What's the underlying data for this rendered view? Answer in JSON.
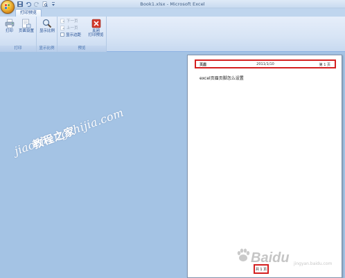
{
  "window": {
    "title": "Book1.xlsx - Microsoft Excel"
  },
  "quick_access": [
    "save-icon",
    "undo-icon",
    "redo-icon",
    "print-preview-icon",
    "customize-icon"
  ],
  "tabs": [
    {
      "label": "打印预览",
      "active": true
    }
  ],
  "ribbon": {
    "groups": [
      {
        "label": "打印",
        "buttons": [
          {
            "label": "打印",
            "icon": "printer-icon"
          },
          {
            "label": "页面设置",
            "icon": "page-setup-icon"
          }
        ]
      },
      {
        "label": "显示比例",
        "buttons": [
          {
            "label": "显示比例",
            "icon": "magnifier-icon"
          }
        ]
      },
      {
        "label": "预览",
        "small_buttons": [
          {
            "label": "下一页",
            "icon": "next-page-icon",
            "enabled": false
          },
          {
            "label": "上一页",
            "icon": "previous-page-icon",
            "enabled": false
          },
          {
            "label": "显示边距",
            "icon": "checkbox",
            "checked": false
          }
        ],
        "buttons": [
          {
            "label": "关闭",
            "label2": "打印预览",
            "icon": "close-preview-icon"
          }
        ]
      }
    ]
  },
  "preview": {
    "header": {
      "left": "页眉",
      "center": "2011/1/10",
      "right": "第 1 页"
    },
    "cell_text": "excel页眉页脚怎么设置",
    "footer": {
      "text": "共 1 页"
    }
  },
  "watermarks": {
    "site": "jiaochengzhijia.com",
    "cn": "教程之家",
    "baidu": "Baidu",
    "baidu_sub": "jingyan.baidu.com"
  },
  "colors": {
    "workspace": "#a4c3e4",
    "highlight": "#d41f1f",
    "ribbon_text": "#15428b"
  }
}
